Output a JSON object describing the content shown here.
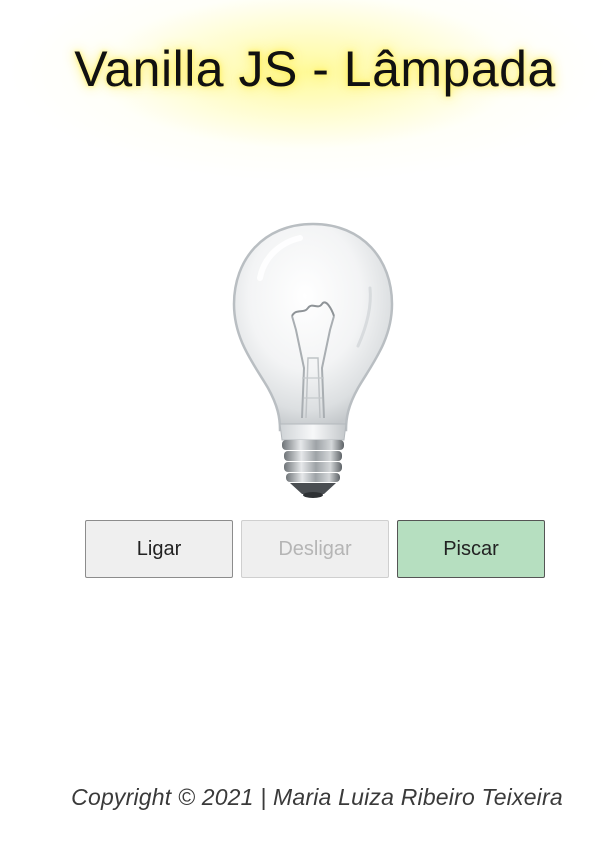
{
  "header": {
    "title": "Vanilla JS - Lâmpada",
    "glow_color": "#fff59a"
  },
  "bulb": {
    "state": "off",
    "icon": "light-bulb-icon"
  },
  "controls": {
    "on_label": "Ligar",
    "off_label": "Desligar",
    "off_disabled": true,
    "blink_label": "Piscar",
    "blink_color": "#b6dfc0"
  },
  "footer": {
    "text": "Copyright © 2021 | Maria Luiza Ribeiro Teixeira"
  }
}
